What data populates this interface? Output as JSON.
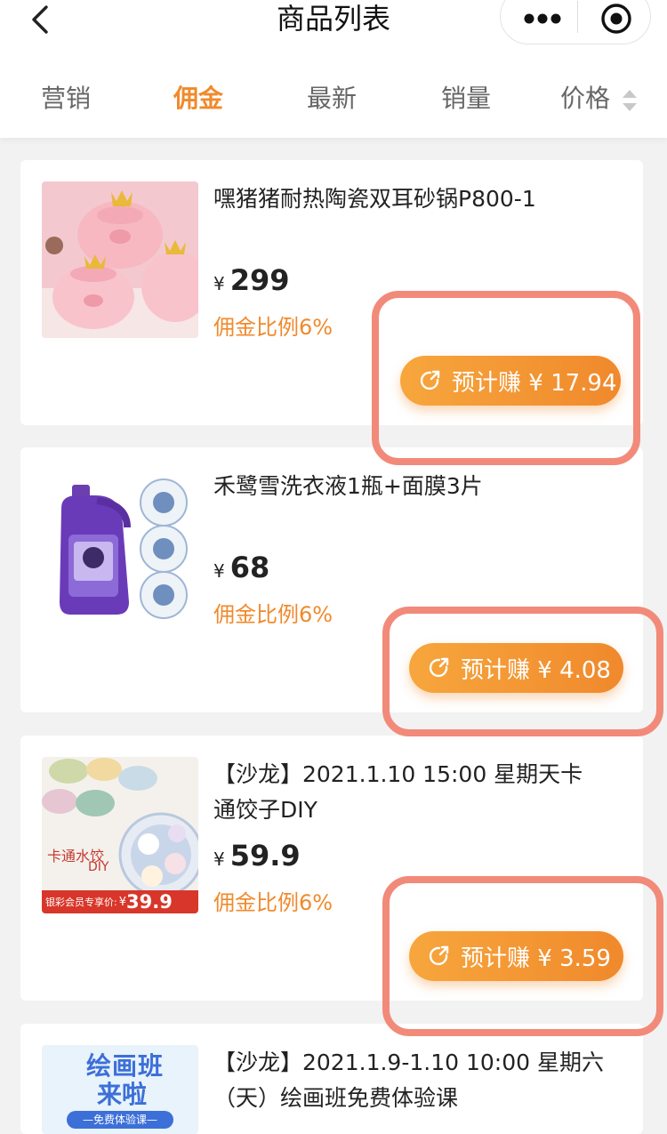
{
  "header": {
    "title": "商品列表",
    "back_icon": "chevron-left-icon",
    "more_icon": "more-dots-icon",
    "close_icon": "target-close-icon"
  },
  "tabs": [
    {
      "label": "营销"
    },
    {
      "label": "佣金",
      "active": true
    },
    {
      "label": "最新"
    },
    {
      "label": "销量"
    },
    {
      "label": "价格",
      "icon": "sort-arrows-icon"
    }
  ],
  "products": [
    {
      "name": "嘿猪猪耐热陶瓷双耳砂锅P800-1",
      "currency": "¥",
      "price": "299",
      "rate": "佣金比例6%",
      "earn": "预计赚 ¥ 17.94",
      "image": "pink-pig-casserole"
    },
    {
      "name": "禾鹭雪洗衣液1瓶+面膜3片",
      "currency": "¥",
      "price": "68",
      "rate": "佣金比例6%",
      "earn": "预计赚 ¥ 4.08",
      "image": "laundry-detergent-masks"
    },
    {
      "name": "【沙龙】2021.1.10 15:00 星期天卡通饺子DIY",
      "currency": "¥",
      "price": "59.9",
      "rate": "佣金比例6%",
      "earn": "预计赚 ¥ 3.59",
      "image": "cartoon-dumplings",
      "promo_label": "银彩会员专享价:",
      "promo_currency": "¥",
      "promo_price": "39.9",
      "image_caption": "卡通水饺",
      "image_caption2": "DIY"
    },
    {
      "name": "【沙龙】2021.1.9-1.10 10:00 星期六（天）绘画班免费体验课",
      "image": "painting-class",
      "poster_line1": "绘画班",
      "poster_line2": "来啦",
      "poster_line3": "—免费体验课—"
    }
  ],
  "colors": {
    "accent": "#f08a2c",
    "highlight": "#f28a7a",
    "background": "#f2f2f2"
  }
}
